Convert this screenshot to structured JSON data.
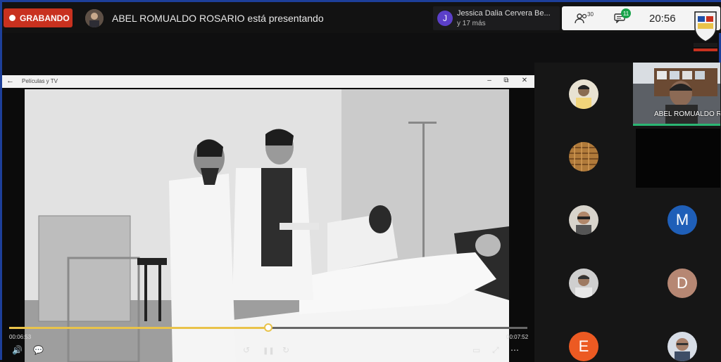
{
  "recording": {
    "label": "GRABANDO"
  },
  "presenter": {
    "text": "ABEL ROMUALDO ROSARIO está presentando"
  },
  "chat_toast": {
    "initial": "J",
    "name": "Jessica Dalia Cervera Be...",
    "sub": "y 17 más"
  },
  "status": {
    "participants": "30",
    "chat_unread": "11",
    "time": "20:56"
  },
  "player": {
    "back": "←",
    "title": "Películas y TV",
    "minimize": "–",
    "restore": "⧉",
    "close": "✕",
    "progress_fraction": 0.5,
    "elapsed": "00:06:53",
    "total": "00:07:52",
    "controls": {
      "volume": "🔊",
      "subtitles": "💬",
      "rewind": "↺",
      "pause": "❚❚",
      "forward": "↻",
      "cast": "▭",
      "fullscreen": "⤢",
      "more": "⋯"
    }
  },
  "gallery": {
    "camera_name": "ABEL ROMUALDO R",
    "letters": {
      "m": "M",
      "d": "D",
      "e": "E"
    },
    "colors": {
      "m": "#1f5fb8",
      "d": "#b68773",
      "e": "#ec5a22",
      "active_speaker": "#2bb673"
    }
  },
  "colors": {
    "record": "#c8311f",
    "progress": "#e9c34a",
    "frame": "#1d3f9a"
  }
}
